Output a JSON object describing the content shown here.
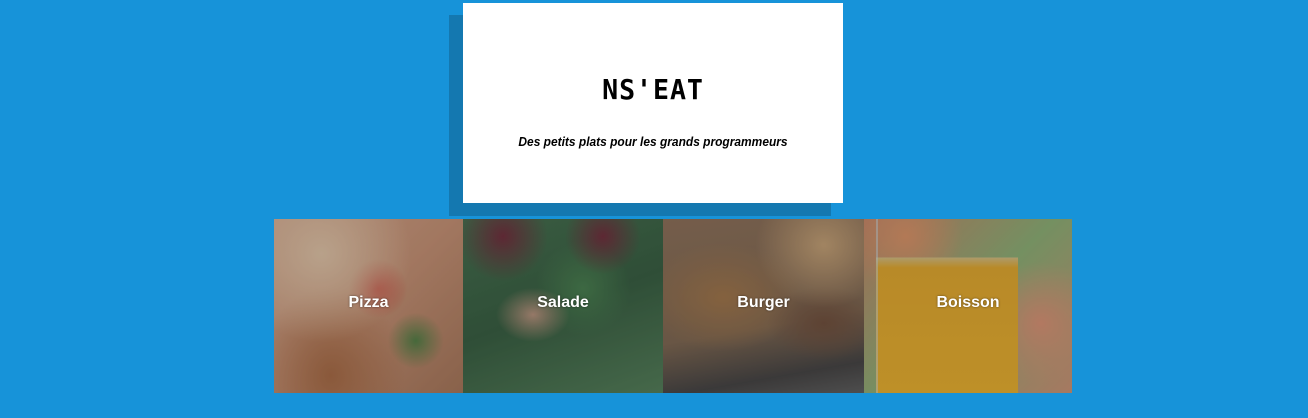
{
  "header": {
    "title": "NS'EAT",
    "subtitle": "Des petits plats pour les grands programmeurs"
  },
  "categories": [
    {
      "label": "Pizza"
    },
    {
      "label": "Salade"
    },
    {
      "label": "Burger"
    },
    {
      "label": "Boisson"
    }
  ],
  "colors": {
    "background": "#1793d9",
    "card": "#ffffff",
    "shadow": "#1478b0"
  }
}
